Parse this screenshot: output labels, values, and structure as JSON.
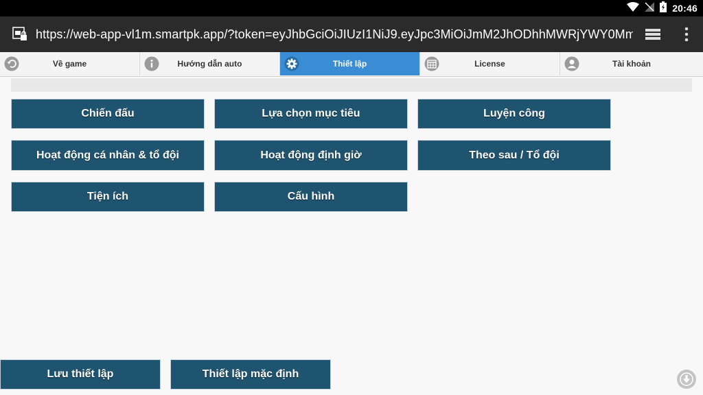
{
  "status_bar": {
    "time": "20:46",
    "icons": [
      "wifi-icon",
      "signal-off-icon",
      "battery-charging-icon"
    ]
  },
  "browser": {
    "url": "https://web-app-vl1m.smartpk.app/?token=eyJhbGciOiJIUzI1NiJ9.eyJpc3MiOiJmM2JhODhhMWRjYWY0Mm",
    "icons": [
      "site-lock-icon",
      "tab-switcher-icon",
      "overflow-menu-icon"
    ]
  },
  "tabs": [
    {
      "label": "Về game",
      "icon": "back-arrow-icon",
      "active": false
    },
    {
      "label": "Hướng dẫn auto",
      "icon": "info-icon",
      "active": false
    },
    {
      "label": "Thiết lập",
      "icon": "gear-icon",
      "active": true
    },
    {
      "label": "License",
      "icon": "calendar-icon",
      "active": false
    },
    {
      "label": "Tài khoản",
      "icon": "user-icon",
      "active": false
    }
  ],
  "settings_buttons": [
    "Chiến đấu",
    "Lựa chọn mục tiêu",
    "Luyện công",
    "Hoạt động cá nhân & tổ đội",
    "Hoạt động định giờ",
    "Theo sau / Tổ đội",
    "Tiện ích",
    "Cấu hình"
  ],
  "footer": {
    "save_label": "Lưu thiết lập",
    "default_label": "Thiết lập mặc định"
  },
  "colors": {
    "button_bg": "#1e5470",
    "active_tab": "#3a8dd4",
    "toolbar": "#2b2b2b"
  }
}
